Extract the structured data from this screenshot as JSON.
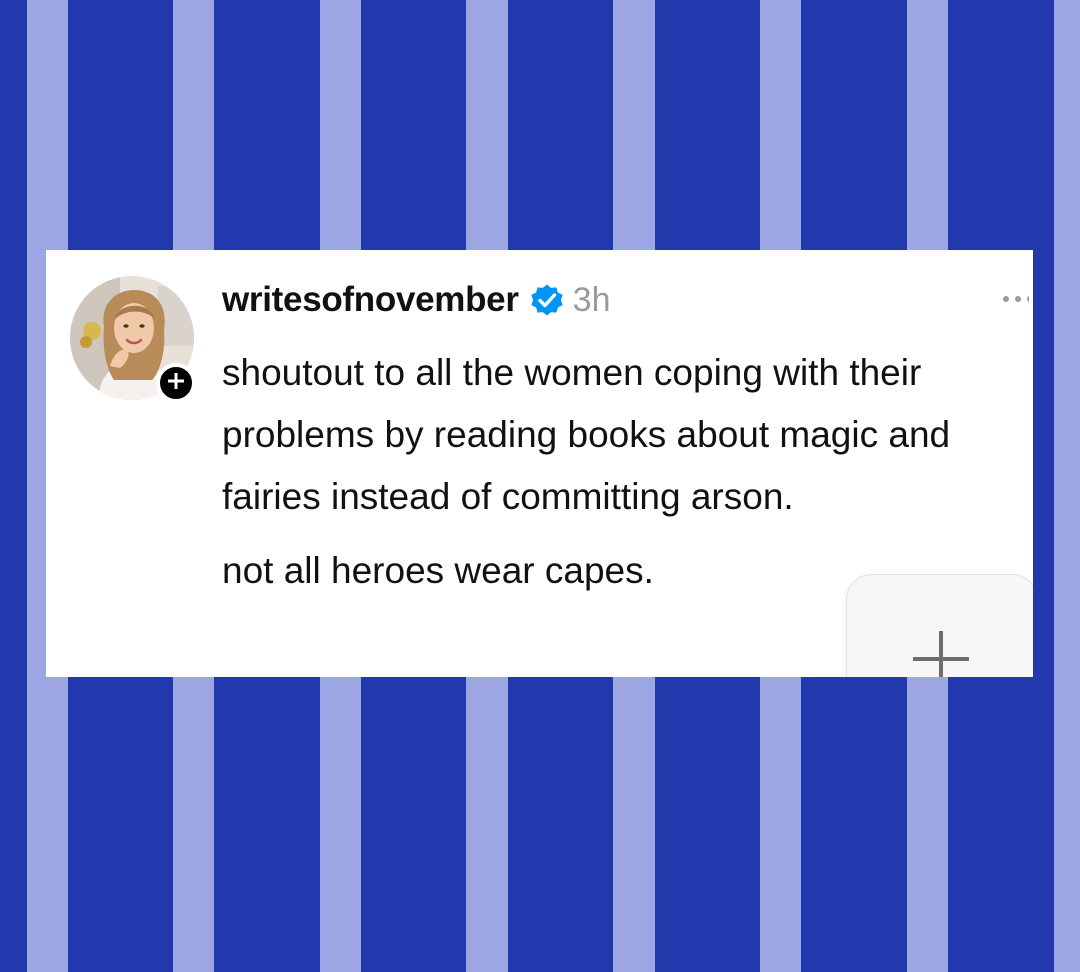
{
  "background": {
    "stripe_dark": "#2238ad",
    "stripe_light": "#9ca6e2"
  },
  "post": {
    "username": "writesofnovember",
    "verified": true,
    "verified_icon": "verified-badge-icon",
    "timestamp": "3h",
    "more_icon": "more-options-icon",
    "follow_icon": "plus-icon",
    "paragraphs": [
      "shoutout to all the women coping with their problems by reading books about magic and fairies instead of committing arson.",
      "not all heroes wear capes."
    ]
  },
  "add_tile": {
    "icon": "plus-icon"
  },
  "colors": {
    "verified_blue": "#0095f6",
    "text": "#111111",
    "timestamp": "#9a9a9a"
  }
}
